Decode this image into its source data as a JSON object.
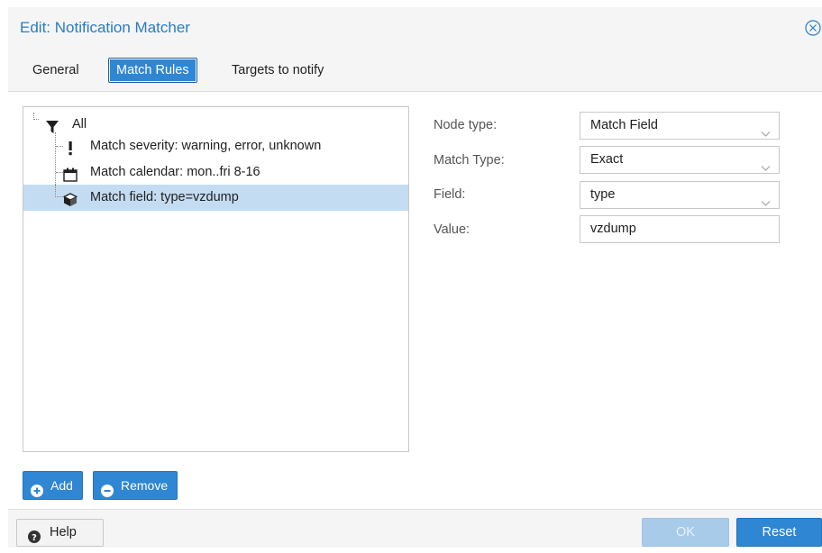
{
  "dialog": {
    "title": "Edit: Notification Matcher"
  },
  "tabs": [
    {
      "label": "General",
      "active": false
    },
    {
      "label": "Match Rules",
      "active": true
    },
    {
      "label": "Targets to notify",
      "active": false
    }
  ],
  "tree": {
    "root": {
      "label": "All",
      "icon": "filter-icon"
    },
    "children": [
      {
        "label": "Match severity: warning, error, unknown",
        "icon": "exclamation-icon",
        "selected": false
      },
      {
        "label": "Match calendar: mon..fri 8-16",
        "icon": "calendar-icon",
        "selected": false
      },
      {
        "label": "Match field: type=vzdump",
        "icon": "cube-icon",
        "selected": true
      }
    ]
  },
  "tree_buttons": {
    "add_label": "Add",
    "remove_label": "Remove"
  },
  "form": {
    "node_type": {
      "label": "Node type:",
      "value": "Match Field"
    },
    "match_type": {
      "label": "Match Type:",
      "value": "Exact"
    },
    "field": {
      "label": "Field:",
      "value": "type"
    },
    "value": {
      "label": "Value:",
      "value": "vzdump"
    }
  },
  "footer": {
    "help_label": "Help",
    "ok_label": "OK",
    "reset_label": "Reset"
  },
  "colors": {
    "accent": "#2f86d3",
    "title": "#2a7cc0",
    "selection": "#c4dcf2"
  }
}
